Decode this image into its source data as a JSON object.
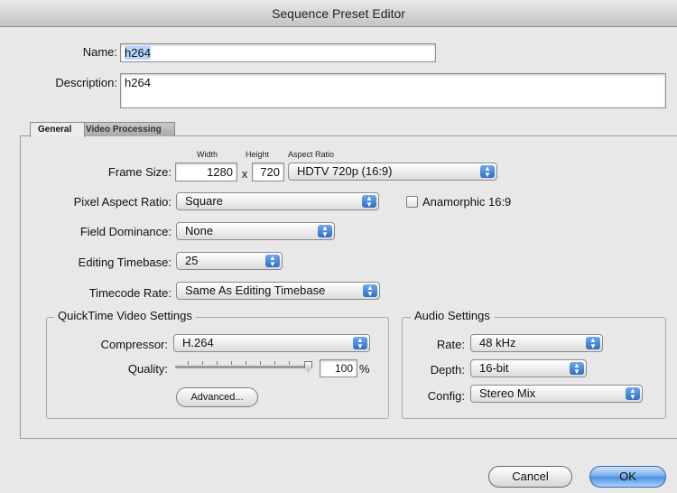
{
  "window": {
    "title": "Sequence Preset Editor"
  },
  "name": {
    "label": "Name:",
    "value": "h264"
  },
  "description": {
    "label": "Description:",
    "value": "h264"
  },
  "tabs": [
    {
      "label": "General",
      "active": true
    },
    {
      "label": "Video Processing",
      "active": false
    }
  ],
  "frame_size": {
    "label": "Frame Size:",
    "width_caption": "Width",
    "height_caption": "Height",
    "aspect_caption": "Aspect Ratio",
    "width": "1280",
    "x_sep": "x",
    "height": "720",
    "aspect_ratio": "HDTV 720p (16:9)"
  },
  "pixel_aspect": {
    "label": "Pixel Aspect Ratio:",
    "value": "Square",
    "anamorphic_label": "Anamorphic 16:9",
    "anamorphic_checked": false
  },
  "field_dominance": {
    "label": "Field Dominance:",
    "value": "None"
  },
  "editing_timebase": {
    "label": "Editing Timebase:",
    "value": "25"
  },
  "timecode_rate": {
    "label": "Timecode Rate:",
    "value": "Same As Editing Timebase"
  },
  "quicktime": {
    "title": "QuickTime Video Settings",
    "compressor_label": "Compressor:",
    "compressor": "H.264",
    "quality_label": "Quality:",
    "quality_value": "100",
    "quality_unit": "%",
    "quality_fraction": 1.0,
    "advanced_label": "Advanced..."
  },
  "audio": {
    "title": "Audio Settings",
    "rate_label": "Rate:",
    "rate": "48 kHz",
    "depth_label": "Depth:",
    "depth": "16-bit",
    "config_label": "Config:",
    "config": "Stereo Mix"
  },
  "buttons": {
    "cancel": "Cancel",
    "ok": "OK"
  },
  "icons": {
    "popup_arrows": "updown-chevron-icon",
    "slider_thumb": "slider-thumb-icon"
  },
  "colors": {
    "accent": "#4a8fe0",
    "selection": "#b5d5ff"
  }
}
